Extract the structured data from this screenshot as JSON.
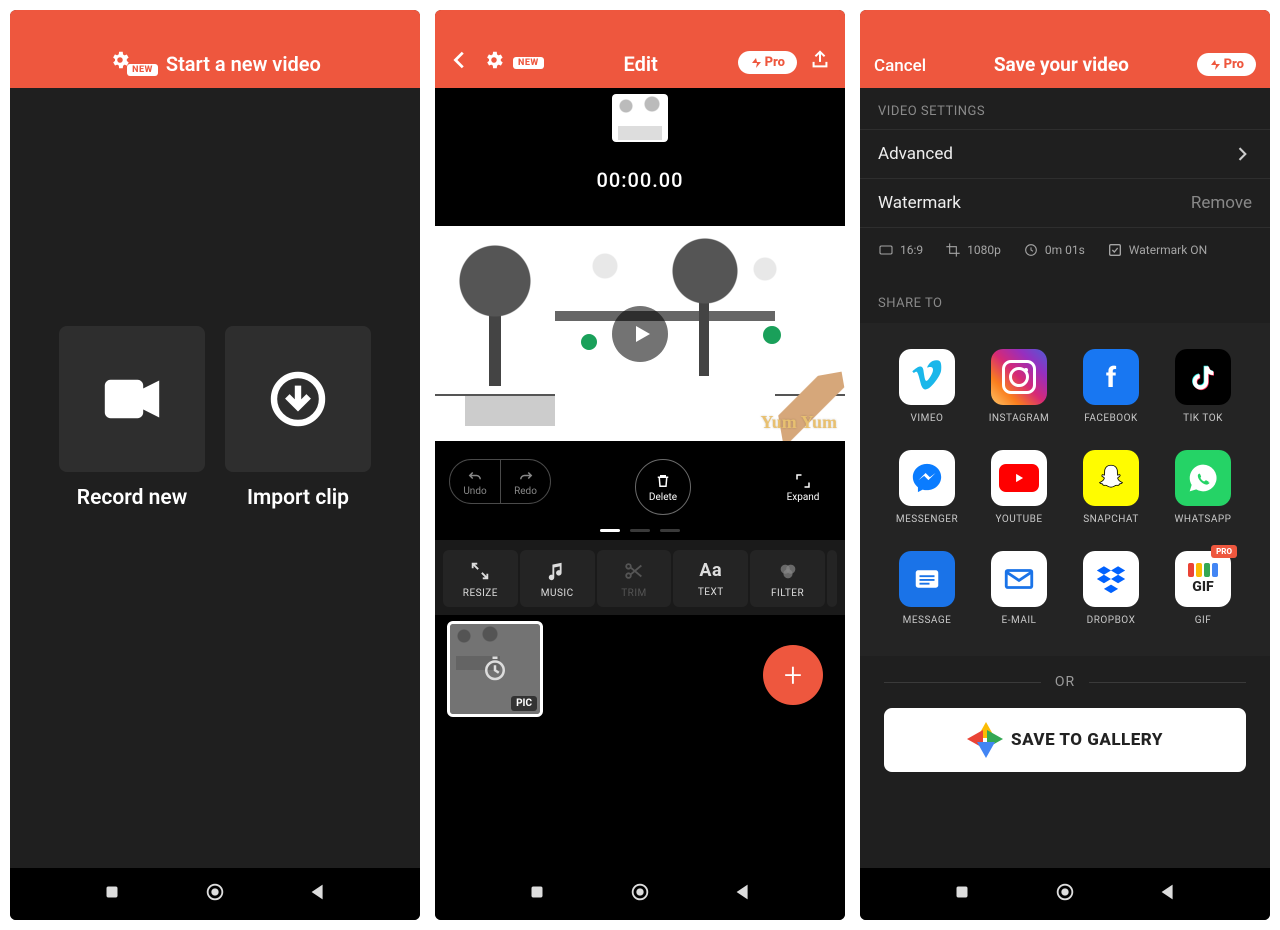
{
  "screen1": {
    "title": "Start a new video",
    "new_badge": "NEW",
    "tiles": {
      "record": "Record new",
      "import": "Import clip"
    }
  },
  "screen2": {
    "title": "Edit",
    "new_badge": "NEW",
    "pro_label": "Pro",
    "timecode": "00:00.00",
    "preview_logo": "Yum Yum",
    "undo": "Undo",
    "redo": "Redo",
    "delete": "Delete",
    "expand": "Expand",
    "tools": {
      "resize": "RESIZE",
      "music": "MUSIC",
      "trim": "TRIM",
      "text": "TEXT",
      "filter": "FILTER"
    },
    "clip_tag": "PIC"
  },
  "screen3": {
    "cancel": "Cancel",
    "title": "Save your video",
    "pro_label": "Pro",
    "section_settings": "VIDEO SETTINGS",
    "advanced": "Advanced",
    "watermark": "Watermark",
    "watermark_action": "Remove",
    "info": {
      "aspect": "16:9",
      "res": "1080p",
      "dur": "0m 01s",
      "wm": "Watermark ON"
    },
    "share_section": "SHARE TO",
    "share": {
      "vimeo": "VIMEO",
      "instagram": "INSTAGRAM",
      "facebook": "FACEBOOK",
      "tiktok": "TIK TOK",
      "messenger": "MESSENGER",
      "youtube": "YOUTUBE",
      "snapchat": "SNAPCHAT",
      "whatsapp": "WHATSAPP",
      "message": "MESSAGE",
      "email": "E-MAIL",
      "dropbox": "DROPBOX",
      "gif": "GIF",
      "gif_pro": "PRO"
    },
    "or": "OR",
    "save_gallery": "SAVE TO GALLERY"
  }
}
